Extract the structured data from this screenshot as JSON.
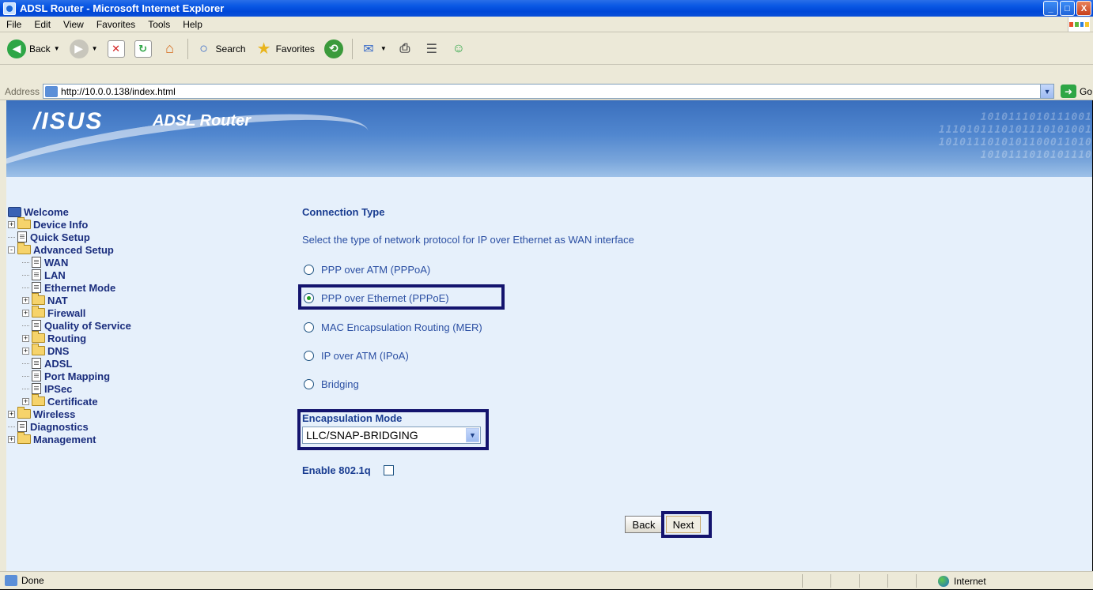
{
  "window": {
    "title": "ADSL Router - Microsoft Internet Explorer",
    "buttons": {
      "minimize": "_",
      "maximize": "□",
      "close": "X"
    }
  },
  "menu": [
    "File",
    "Edit",
    "View",
    "Favorites",
    "Tools",
    "Help"
  ],
  "toolbar": {
    "back_label": "Back",
    "search_label": "Search",
    "favorites_label": "Favorites"
  },
  "address": {
    "label": "Address",
    "url": "http://10.0.0.138/index.html",
    "go_label": "Go"
  },
  "banner": {
    "logo": "/ISUS",
    "product": "ADSL Router",
    "binary_lines": [
      "1010111010111001",
      "1110101110101110101001",
      "1010111010101100011010",
      "1010111010101110"
    ]
  },
  "sidebar": {
    "items": [
      {
        "label": "Welcome",
        "level": 0,
        "icon": "computer-icon",
        "toggle": ""
      },
      {
        "label": "Device Info",
        "level": 0,
        "icon": "folder-icon",
        "toggle": "+"
      },
      {
        "label": "Quick Setup",
        "level": 0,
        "icon": "document-icon",
        "toggle": ""
      },
      {
        "label": "Advanced Setup",
        "level": 0,
        "icon": "folder-open-icon",
        "toggle": "-"
      },
      {
        "label": "WAN",
        "level": 1,
        "icon": "document-icon",
        "toggle": ""
      },
      {
        "label": "LAN",
        "level": 1,
        "icon": "document-icon",
        "toggle": ""
      },
      {
        "label": "Ethernet Mode",
        "level": 1,
        "icon": "document-icon",
        "toggle": ""
      },
      {
        "label": "NAT",
        "level": 1,
        "icon": "folder-icon",
        "toggle": "+"
      },
      {
        "label": "Firewall",
        "level": 1,
        "icon": "folder-icon",
        "toggle": "+"
      },
      {
        "label": "Quality of Service",
        "level": 1,
        "icon": "document-icon",
        "toggle": ""
      },
      {
        "label": "Routing",
        "level": 1,
        "icon": "folder-icon",
        "toggle": "+"
      },
      {
        "label": "DNS",
        "level": 1,
        "icon": "folder-icon",
        "toggle": "+"
      },
      {
        "label": "ADSL",
        "level": 1,
        "icon": "document-icon",
        "toggle": ""
      },
      {
        "label": "Port Mapping",
        "level": 1,
        "icon": "document-icon",
        "toggle": ""
      },
      {
        "label": "IPSec",
        "level": 1,
        "icon": "document-icon",
        "toggle": ""
      },
      {
        "label": "Certificate",
        "level": 1,
        "icon": "folder-icon",
        "toggle": "+"
      },
      {
        "label": "Wireless",
        "level": 0,
        "icon": "folder-icon",
        "toggle": "+"
      },
      {
        "label": "Diagnostics",
        "level": 0,
        "icon": "document-icon",
        "toggle": ""
      },
      {
        "label": "Management",
        "level": 0,
        "icon": "folder-icon",
        "toggle": "+"
      }
    ]
  },
  "form": {
    "heading": "Connection Type",
    "description": "Select the type of network protocol for IP over Ethernet as WAN interface",
    "options": [
      {
        "label": "PPP over ATM (PPPoA)",
        "checked": false
      },
      {
        "label": "PPP over Ethernet (PPPoE)",
        "checked": true
      },
      {
        "label": "MAC Encapsulation Routing (MER)",
        "checked": false
      },
      {
        "label": "IP over ATM (IPoA)",
        "checked": false
      },
      {
        "label": "Bridging",
        "checked": false
      }
    ],
    "encapsulation_label": "Encapsulation Mode",
    "encapsulation_value": "LLC/SNAP-BRIDGING",
    "enable_8021q_label": "Enable 802.1q",
    "enable_8021q_checked": false,
    "back_button": "Back",
    "next_button": "Next",
    "highlight_color": "#14146e"
  },
  "status": {
    "text": "Done",
    "zone": "Internet"
  }
}
